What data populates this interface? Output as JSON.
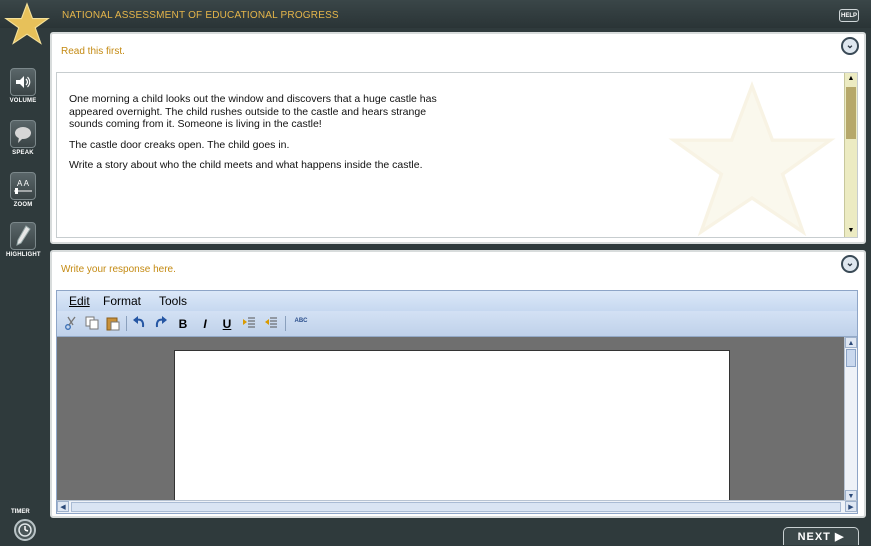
{
  "header": {
    "title": "NATIONAL ASSESSMENT OF EDUCATIONAL PROGRESS",
    "help_label": "HELP"
  },
  "tools": [
    {
      "label": "VOLUME",
      "icon": "volume-icon"
    },
    {
      "label": "SPEAK",
      "icon": "speak-icon",
      "badge": "SPEAK"
    },
    {
      "label": "ZOOM",
      "icon": "zoom-icon",
      "letters": "A A"
    },
    {
      "label": "HIGHLIGHT",
      "icon": "highlight-pen-icon"
    }
  ],
  "prompt_panel": {
    "heading": "Read this first.",
    "paragraphs": [
      "One morning a child looks out the window and discovers that a huge castle has appeared overnight. The child rushes outside to the castle and hears strange sounds coming from it. Someone is living in the castle!",
      "The castle door creaks open. The child goes in.",
      "Write a story about who the child meets and what happens inside the castle."
    ]
  },
  "response_panel": {
    "heading": "Write your response here.",
    "menu": [
      "Edit",
      "Format",
      "Tools"
    ],
    "toolbar": {
      "bold": "B",
      "italic": "I",
      "underline": "U",
      "spellcheck": "ABC"
    },
    "document_text": ""
  },
  "footer": {
    "timer_label": "TIMER",
    "next_label": "NEXT ▶"
  },
  "colors": {
    "accent": "#c48a12",
    "chrome": "#2f3a3c"
  }
}
